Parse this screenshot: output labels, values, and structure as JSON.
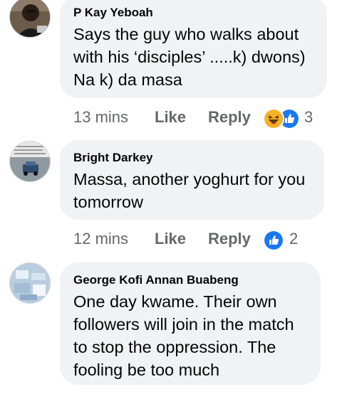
{
  "comments": [
    {
      "author": "P Kay Yeboah",
      "text_lines": [
        "Says the guy who walks about",
        "with his ‘disciples’ .....k) dwons)",
        "Na k) da masa"
      ],
      "time": "13 mins",
      "like_label": "Like",
      "reply_label": "Reply",
      "reactions": [
        "haha-icon",
        "like-icon"
      ],
      "reaction_count": "3"
    },
    {
      "author": "Bright Darkey",
      "text_lines": [
        "Massa, another yoghurt for you",
        "tomorrow"
      ],
      "time": "12 mins",
      "like_label": "Like",
      "reply_label": "Reply",
      "reactions": [
        "like-icon"
      ],
      "reaction_count": "2"
    },
    {
      "author": "George Kofi Annan Buabeng",
      "text_lines": [
        "One day kwame. Their own",
        "followers will join in the match",
        "to stop the oppression. The",
        "fooling be too much"
      ]
    }
  ],
  "colors": {
    "bubble": "#f0f2f5",
    "meta_text": "#65676b",
    "like_blue": "#1877f2",
    "haha_yellow": "#f7b125"
  }
}
